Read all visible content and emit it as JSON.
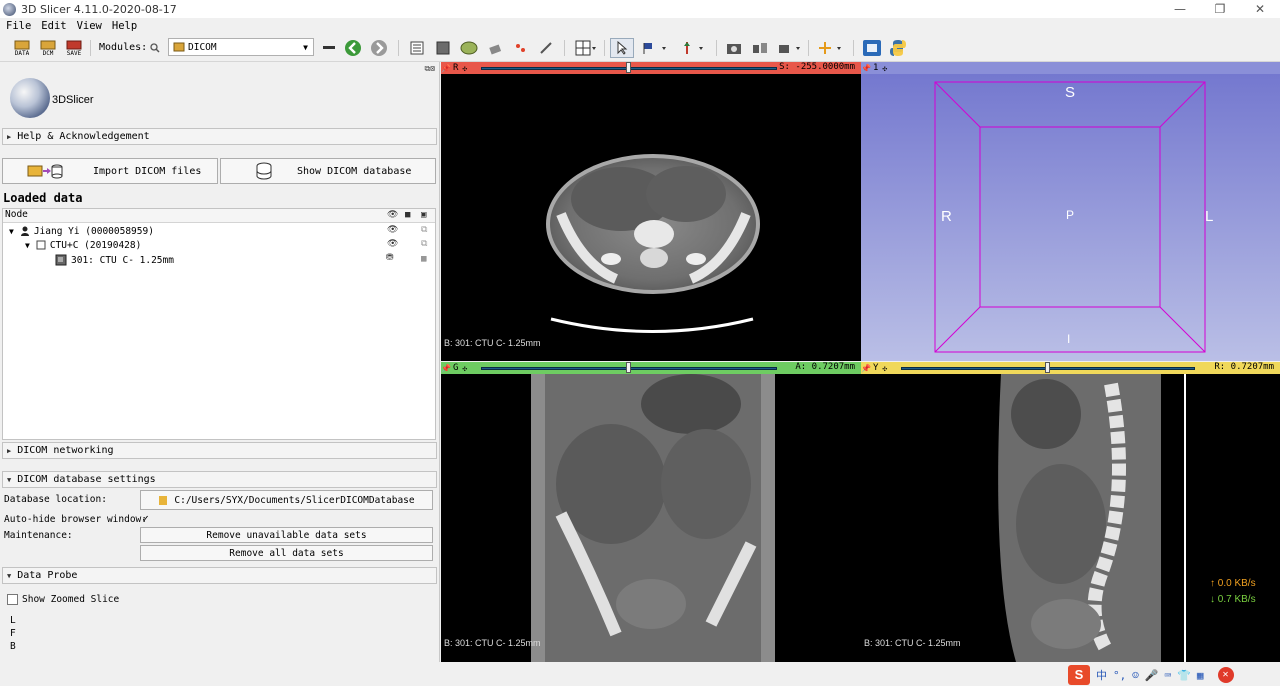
{
  "window": {
    "title": "3D Slicer 4.11.0-2020-08-17"
  },
  "menu": {
    "items": [
      "File",
      "Edit",
      "View",
      "Help"
    ]
  },
  "toolbar": {
    "data_label": "DATA",
    "dcm_label": "DCM",
    "save_label": "SAVE",
    "modules_label": "Modules:",
    "module_selected": "DICOM"
  },
  "left_panel": {
    "logo_text": "3DSlicer",
    "help_section": "Help & Acknowledgement",
    "import_button": "Import DICOM files",
    "show_db_button": "Show DICOM database",
    "loaded_title": "Loaded data",
    "tree_header": "Node",
    "tree_rows": [
      {
        "label": "Jiang Yi (0000058959)"
      },
      {
        "label": "CTU+C (20190428)"
      },
      {
        "label": "301: CTU C- 1.25mm"
      }
    ],
    "networking_section": "DICOM networking",
    "db_settings_section": "DICOM database settings",
    "db_location_label": "Database location:",
    "db_location_value": "C:/Users/SYX/Documents/SlicerDICOMDatabase",
    "autohide_label": "Auto-hide browser window:",
    "autohide_checked": true,
    "maintenance_label": "Maintenance:",
    "remove_unavailable": "Remove unavailable data sets",
    "remove_all": "Remove all data sets",
    "data_probe_section": "Data Probe",
    "show_zoomed": "Show Zoomed Slice",
    "probe_lines": [
      "L",
      "F",
      "B"
    ]
  },
  "views": {
    "red": {
      "name": "R",
      "offset": "S: -255.0000mm",
      "color": "#e8574a",
      "bg_label": "B: 301: CTU C- 1.25mm"
    },
    "threed": {
      "name": "1",
      "color": "#8a8fd8",
      "labels": {
        "top": "S",
        "left": "R",
        "right": "L",
        "center": "P",
        "bottom": "I"
      }
    },
    "green": {
      "name": "G",
      "offset": "A: 0.7207mm",
      "color": "#6ecc62",
      "bg_label": "B: 301: CTU C- 1.25mm"
    },
    "yellow": {
      "name": "Y",
      "offset": "R: 0.7207mm",
      "color": "#f0d85a",
      "bg_label": "B: 301: CTU C- 1.25mm"
    }
  },
  "netspeed": {
    "up": "↑ 0.0 KB/s",
    "down": "↓ 0.7 KB/s"
  },
  "tray": {
    "ime_label": "中"
  }
}
